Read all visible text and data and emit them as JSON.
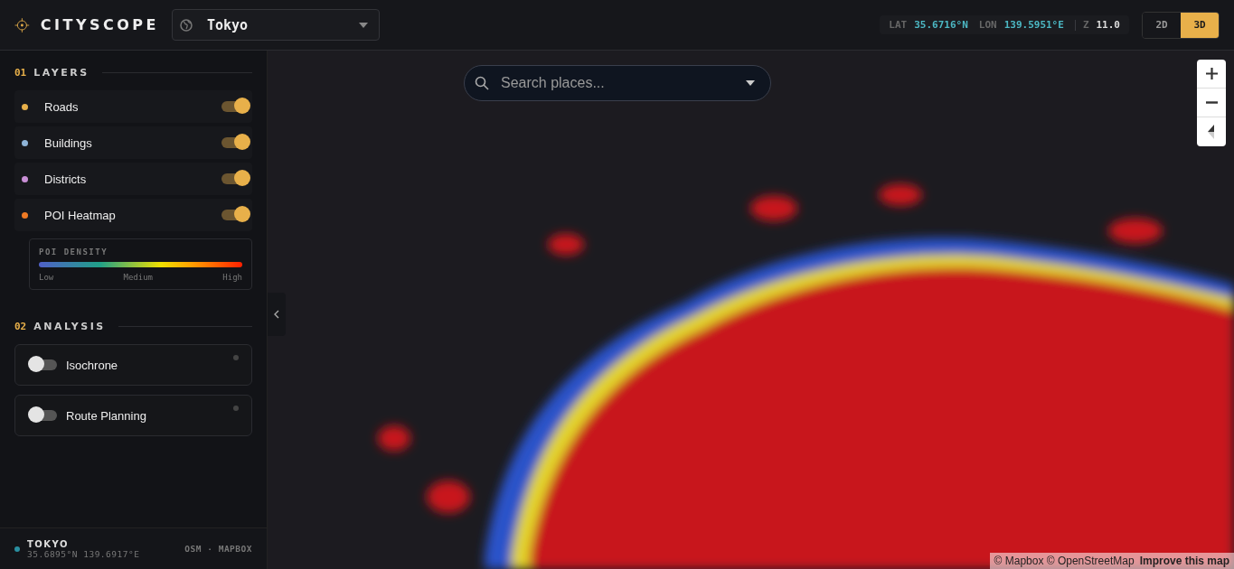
{
  "header": {
    "brand": "CITYSCOPE",
    "city_select": {
      "value": "Tokyo"
    },
    "coordinates": {
      "lat_label": "LAT",
      "lat": "35.6716°N",
      "lon_label": "LON",
      "lon": "139.5951°E",
      "zoom_label": "Z",
      "zoom": "11.0"
    },
    "view_modes": [
      {
        "label": "2D",
        "selected": false
      },
      {
        "label": "3D",
        "selected": true
      }
    ]
  },
  "sidebar": {
    "layers_section": {
      "number": "01",
      "title": "LAYERS"
    },
    "layers": [
      {
        "label": "Roads",
        "color": "#e8b04a",
        "on": true
      },
      {
        "label": "Buildings",
        "color": "#8fb4d8",
        "on": true
      },
      {
        "label": "Districts",
        "color": "#c98fd6",
        "on": true
      },
      {
        "label": "POI Heatmap",
        "color": "#ef7a24",
        "on": true
      }
    ],
    "legend": {
      "title": "POI DENSITY",
      "labels": [
        "Low",
        "Medium",
        "High"
      ]
    },
    "analysis_section": {
      "number": "02",
      "title": "ANALYSIS"
    },
    "analysis": [
      {
        "label": "Isochrone",
        "on": false
      },
      {
        "label": "Route Planning",
        "on": false
      }
    ],
    "footer": {
      "city": "TOKYO",
      "coordinates": "35.6895°N 139.6917°E",
      "sources": "OSM · MAPBOX"
    }
  },
  "map": {
    "search": {
      "placeholder": "Search places..."
    },
    "attribution": "© Mapbox © OpenStreetMap",
    "improve_link": "Improve this map"
  }
}
